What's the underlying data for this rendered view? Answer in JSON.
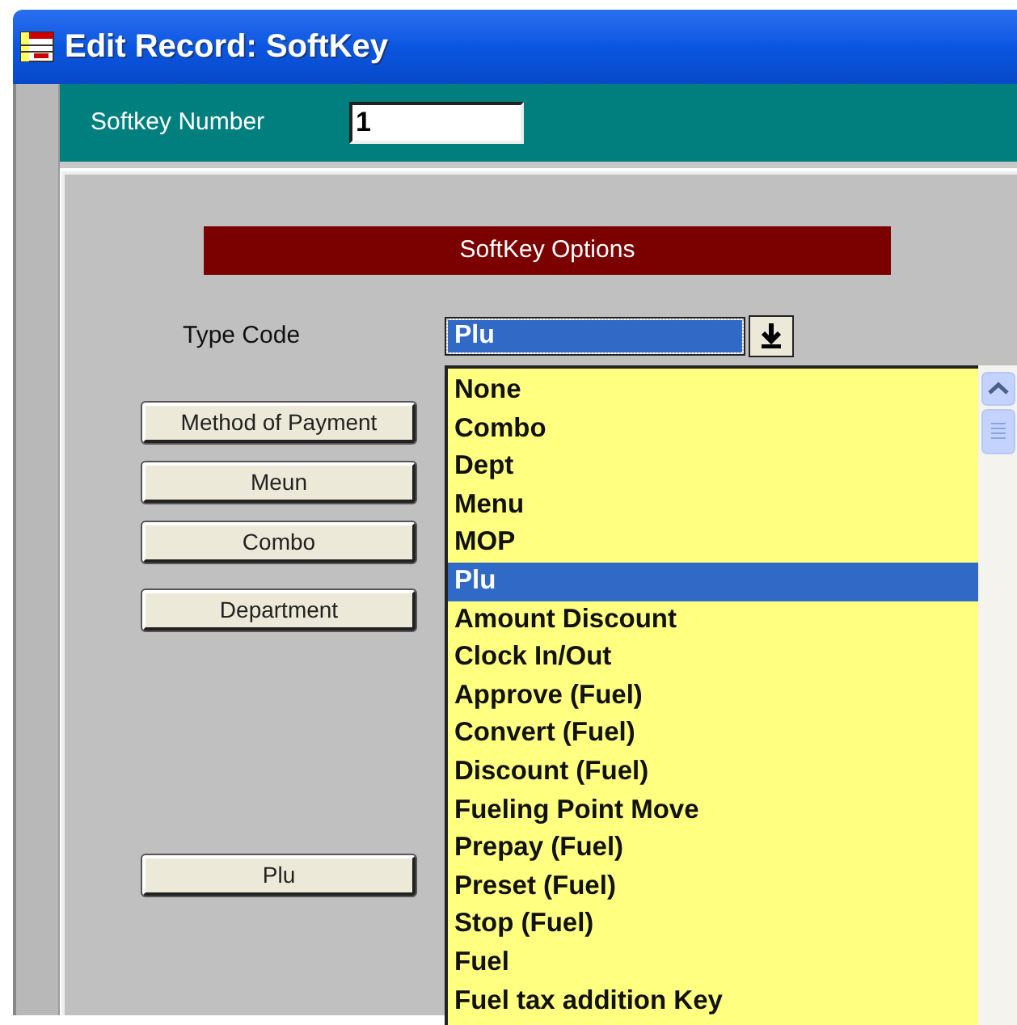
{
  "window": {
    "title": "Edit Record: SoftKey"
  },
  "softkey_number": {
    "label": "Softkey Number",
    "value": "1"
  },
  "section_title": "SoftKey Options",
  "type_code": {
    "label": "Type Code",
    "value": "Plu",
    "expanded": true
  },
  "buttons": [
    "Method of Payment",
    "Meun",
    "Combo",
    "Department",
    "Plu"
  ],
  "options": [
    {
      "label": "None",
      "selected": false
    },
    {
      "label": "Combo",
      "selected": false
    },
    {
      "label": "Dept",
      "selected": false
    },
    {
      "label": "Menu",
      "selected": false
    },
    {
      "label": "MOP",
      "selected": false
    },
    {
      "label": "Plu",
      "selected": true
    },
    {
      "label": "Amount Discount",
      "selected": false
    },
    {
      "label": "Clock In/Out",
      "selected": false
    },
    {
      "label": "Approve (Fuel)",
      "selected": false
    },
    {
      "label": "Convert (Fuel)",
      "selected": false
    },
    {
      "label": "Discount (Fuel)",
      "selected": false
    },
    {
      "label": "Fueling Point Move",
      "selected": false
    },
    {
      "label": "Prepay (Fuel)",
      "selected": false
    },
    {
      "label": "Preset (Fuel)",
      "selected": false
    },
    {
      "label": "Stop (Fuel)",
      "selected": false
    },
    {
      "label": "Fuel",
      "selected": false
    },
    {
      "label": "Fuel tax addition Key",
      "selected": false
    }
  ]
}
